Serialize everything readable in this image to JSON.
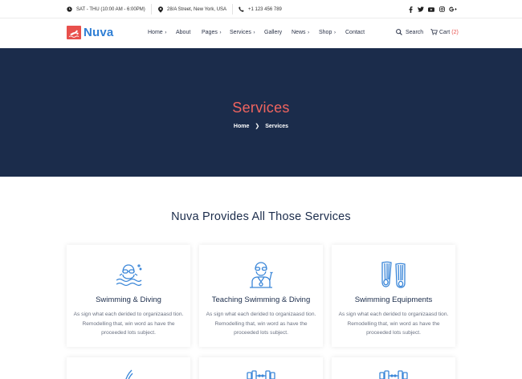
{
  "topbar": {
    "hours": "SAT - THU (10:00 AM - 6:00PM)",
    "address": "28/A Street, New York, USA",
    "phone": "+1 123 456 789",
    "social_icons": [
      "facebook-icon",
      "twitter-icon",
      "youtube-icon",
      "instagram-icon",
      "google-plus-icon"
    ]
  },
  "header": {
    "logo_text": "Nuva",
    "nav": [
      {
        "label": "Home",
        "has_dropdown": true
      },
      {
        "label": "About",
        "has_dropdown": false
      },
      {
        "label": "Pages",
        "has_dropdown": true
      },
      {
        "label": "Services",
        "has_dropdown": true
      },
      {
        "label": "Gallery",
        "has_dropdown": false
      },
      {
        "label": "News",
        "has_dropdown": true
      },
      {
        "label": "Shop",
        "has_dropdown": true
      },
      {
        "label": "Contact",
        "has_dropdown": false
      }
    ],
    "search_label": "Search",
    "cart_label": "Cart",
    "cart_count": "(2)"
  },
  "hero": {
    "title": "Services",
    "breadcrumb_home": "Home",
    "breadcrumb_sep": "❯",
    "breadcrumb_current": "Services"
  },
  "section": {
    "title": "Nuva Provides All Those Services"
  },
  "cards": [
    {
      "icon": "swimmer-icon",
      "title": "Swimming & Diving",
      "desc": "As sign what each derided to organizaasd tion. Remodelling that, win word as have the proceeded lots subject."
    },
    {
      "icon": "coach-icon",
      "title": "Teaching Swimming & Diving",
      "desc": "As sign what each derided to organizaasd tion. Remodelling that, win word as have the proceeded lots subject."
    },
    {
      "icon": "flippers-icon",
      "title": "Swimming Equipments",
      "desc": "As sign what each derided to organizaasd tion. Remodelling that, win word as have the proceeded lots subject."
    }
  ],
  "colors": {
    "accent": "#f0645f",
    "brand_blue": "#2f7fd5",
    "hero_bg": "#1b2c4b",
    "icon_blue": "#3a86d8"
  }
}
